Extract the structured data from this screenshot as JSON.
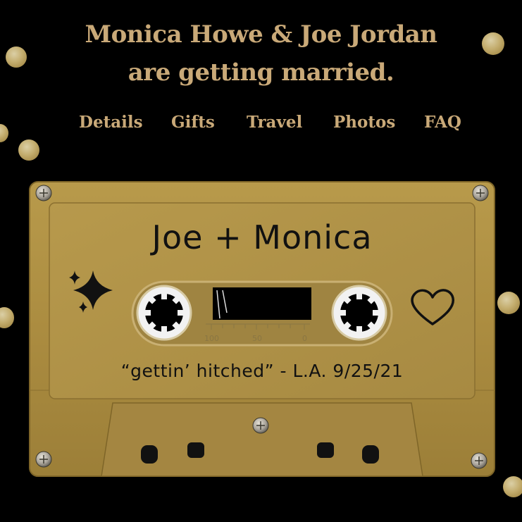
{
  "header": {
    "title_line1": "Monica Howe & Joe Jordan",
    "title_line2": "are getting married."
  },
  "nav": {
    "items": [
      {
        "label": "Details"
      },
      {
        "label": "Gifts"
      },
      {
        "label": "Travel"
      },
      {
        "label": "Photos"
      },
      {
        "label": "FAQ"
      }
    ]
  },
  "cassette": {
    "label_main": "Joe + Monica",
    "label_sub": "“gettin’ hitched” - L.A. 9/25/21",
    "scale_labels": [
      "100",
      "50",
      "0"
    ]
  },
  "colors": {
    "background": "#000000",
    "accent": "#c9a978",
    "cassette_gold": "#b29546"
  },
  "icons": [
    "sparkle-icon",
    "heart-icon",
    "screw-icon"
  ]
}
